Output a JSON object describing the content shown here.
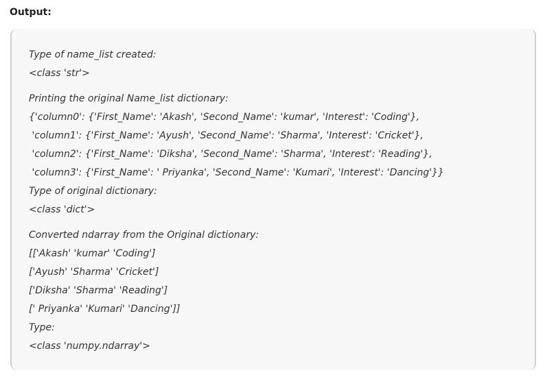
{
  "heading": "Output:",
  "output_lines": [
    "Type of name_list created:",
    "<class 'str'>",
    "Printing the original Name_list dictionary:",
    "{'column0': {'First_Name': 'Akash', 'Second_Name': 'kumar', 'Interest': 'Coding'},",
    " 'column1': {'First_Name': 'Ayush', 'Second_Name': 'Sharma', 'Interest': 'Cricket'},",
    " 'column2': {'First_Name': 'Diksha', 'Second_Name': 'Sharma', 'Interest': 'Reading'},",
    " 'column3': {'First_Name': ' Priyanka', 'Second_Name': 'Kumari', 'Interest': 'Dancing'}}",
    "Type of original dictionary:",
    "<class 'dict'>",
    "Converted ndarray from the Original dictionary:",
    "[['Akash' 'kumar' 'Coding']",
    "['Ayush' 'Sharma' 'Cricket']",
    "['Diksha' 'Sharma' 'Reading']",
    "[' Priyanka' 'Kumari' 'Dancing']]",
    "Type:",
    "<class 'numpy.ndarray'>"
  ]
}
